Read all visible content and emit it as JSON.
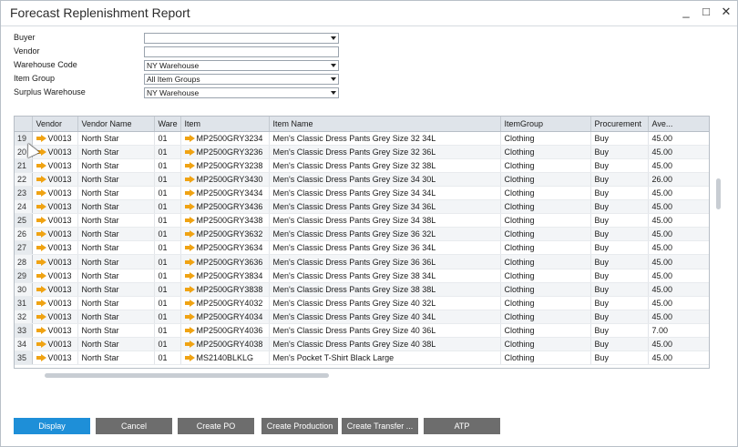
{
  "window": {
    "title": "Forecast Replenishment Report",
    "controls": {
      "minimize": "_",
      "maximize": "□",
      "close": "✕"
    }
  },
  "filters": [
    {
      "label": "Buyer",
      "value": "",
      "dropdown": true
    },
    {
      "label": "Vendor",
      "value": "",
      "dropdown": false
    },
    {
      "label": "Warehouse Code",
      "value": "NY Warehouse",
      "dropdown": true
    },
    {
      "label": "Item Group",
      "value": "All Item Groups",
      "dropdown": true
    },
    {
      "label": "Surplus Warehouse",
      "value": "NY Warehouse",
      "dropdown": true
    }
  ],
  "grid": {
    "columns": [
      "",
      "Vendor",
      "Vendor Name",
      "Ware",
      "Item",
      "Item Name",
      "ItemGroup",
      "Procurement",
      "Ave..."
    ],
    "rows": [
      [
        "19",
        "V0013",
        "North Star",
        "01",
        "MP2500GRY3234",
        "Men's Classic Dress Pants Grey Size 32 34L",
        "Clothing",
        "Buy",
        "45.00"
      ],
      [
        "20",
        "V0013",
        "North Star",
        "01",
        "MP2500GRY3236",
        "Men's Classic Dress Pants Grey Size 32 36L",
        "Clothing",
        "Buy",
        "45.00"
      ],
      [
        "21",
        "V0013",
        "North Star",
        "01",
        "MP2500GRY3238",
        "Men's Classic Dress Pants Grey Size 32 38L",
        "Clothing",
        "Buy",
        "45.00"
      ],
      [
        "22",
        "V0013",
        "North Star",
        "01",
        "MP2500GRY3430",
        "Men's Classic Dress Pants Grey Size 34 30L",
        "Clothing",
        "Buy",
        "26.00"
      ],
      [
        "23",
        "V0013",
        "North Star",
        "01",
        "MP2500GRY3434",
        "Men's Classic Dress Pants Grey Size 34 34L",
        "Clothing",
        "Buy",
        "45.00"
      ],
      [
        "24",
        "V0013",
        "North Star",
        "01",
        "MP2500GRY3436",
        "Men's Classic Dress Pants Grey Size 34 36L",
        "Clothing",
        "Buy",
        "45.00"
      ],
      [
        "25",
        "V0013",
        "North Star",
        "01",
        "MP2500GRY3438",
        "Men's Classic Dress Pants Grey Size 34 38L",
        "Clothing",
        "Buy",
        "45.00"
      ],
      [
        "26",
        "V0013",
        "North Star",
        "01",
        "MP2500GRY3632",
        "Men's Classic Dress Pants Grey Size 36 32L",
        "Clothing",
        "Buy",
        "45.00"
      ],
      [
        "27",
        "V0013",
        "North Star",
        "01",
        "MP2500GRY3634",
        "Men's Classic Dress Pants Grey Size 36 34L",
        "Clothing",
        "Buy",
        "45.00"
      ],
      [
        "28",
        "V0013",
        "North Star",
        "01",
        "MP2500GRY3636",
        "Men's Classic Dress Pants Grey Size 36 36L",
        "Clothing",
        "Buy",
        "45.00"
      ],
      [
        "29",
        "V0013",
        "North Star",
        "01",
        "MP2500GRY3834",
        "Men's Classic Dress Pants Grey Size 38 34L",
        "Clothing",
        "Buy",
        "45.00"
      ],
      [
        "30",
        "V0013",
        "North Star",
        "01",
        "MP2500GRY3838",
        "Men's Classic Dress Pants Grey Size 38 38L",
        "Clothing",
        "Buy",
        "45.00"
      ],
      [
        "31",
        "V0013",
        "North Star",
        "01",
        "MP2500GRY4032",
        "Men's Classic Dress Pants Grey Size 40 32L",
        "Clothing",
        "Buy",
        "45.00"
      ],
      [
        "32",
        "V0013",
        "North Star",
        "01",
        "MP2500GRY4034",
        "Men's Classic Dress Pants Grey Size 40 34L",
        "Clothing",
        "Buy",
        "45.00"
      ],
      [
        "33",
        "V0013",
        "North Star",
        "01",
        "MP2500GRY4036",
        "Men's Classic Dress Pants Grey Size 40 36L",
        "Clothing",
        "Buy",
        "7.00"
      ],
      [
        "34",
        "V0013",
        "North Star",
        "01",
        "MP2500GRY4038",
        "Men's Classic Dress Pants Grey Size 40 38L",
        "Clothing",
        "Buy",
        "45.00"
      ],
      [
        "35",
        "V0013",
        "North Star",
        "01",
        "MS2140BLKLG",
        "Men's Pocket T-Shirt Black Large",
        "Clothing",
        "Buy",
        "45.00"
      ]
    ]
  },
  "buttons": [
    "Display",
    "Cancel",
    "Create PO",
    "Create Production",
    "Create Transfer ...",
    "ATP"
  ],
  "icons": {
    "link_arrow": "orange-right-arrow-icon"
  },
  "colors": {
    "primary_button": "#1e8fd8",
    "secondary_button": "#6d6d6d",
    "link_arrow": "#f0a313"
  }
}
